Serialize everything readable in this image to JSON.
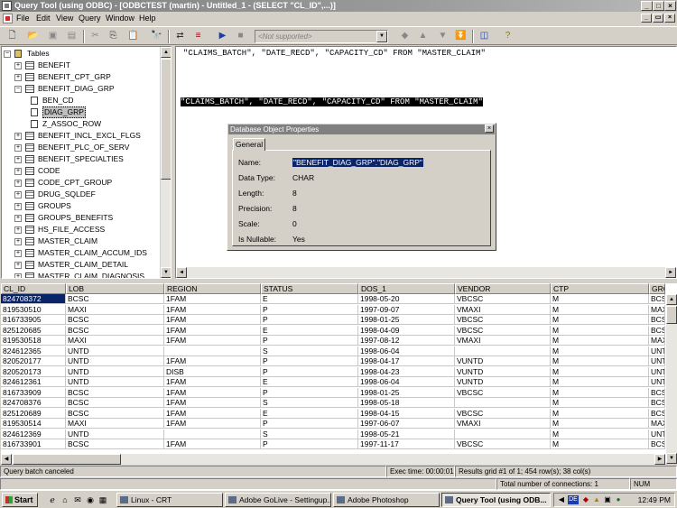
{
  "window": {
    "title": "Query Tool (using ODBC) - [ODBCTEST (martin) - Untitled_1 - (SELECT \"CL_ID\",...)]"
  },
  "menu": [
    "File",
    "Edit",
    "View",
    "Query",
    "Window",
    "Help"
  ],
  "toolbar": {
    "combo_placeholder": "<Not supported>"
  },
  "tree": {
    "root": "Tables",
    "items": [
      {
        "label": "BENEFIT",
        "expanded": false
      },
      {
        "label": "BENEFIT_CPT_GRP",
        "expanded": false
      },
      {
        "label": "BENEFIT_DIAG_GRP",
        "expanded": true
      },
      {
        "label": "BEN_CD",
        "child": true
      },
      {
        "label": "DIAG_GRP",
        "child": true,
        "selected": true
      },
      {
        "label": "Z_ASSOC_ROW",
        "child": true
      },
      {
        "label": "BENEFIT_INCL_EXCL_FLGS",
        "expanded": false
      },
      {
        "label": "BENEFIT_PLC_OF_SERV",
        "expanded": false
      },
      {
        "label": "BENEFIT_SPECIALTIES",
        "expanded": false
      },
      {
        "label": "CODE",
        "expanded": false
      },
      {
        "label": "CODE_CPT_GROUP",
        "expanded": false
      },
      {
        "label": "DRUG_SQLDEF",
        "expanded": false
      },
      {
        "label": "GROUPS",
        "expanded": false
      },
      {
        "label": "GROUPS_BENEFITS",
        "expanded": false
      },
      {
        "label": "HS_FILE_ACCESS",
        "expanded": false
      },
      {
        "label": "MASTER_CLAIM",
        "expanded": false
      },
      {
        "label": "MASTER_CLAIM_ACCUM_IDS",
        "expanded": false
      },
      {
        "label": "MASTER_CLAIM_DETAIL",
        "expanded": false
      },
      {
        "label": "MASTER_CLAIM_DIAGNOSIS",
        "expanded": false
      }
    ]
  },
  "sql": {
    "line1": "\"CLAIMS_BATCH\", \"DATE_RECD\", \"CAPACITY_CD\" FROM \"MASTER_CLAIM\"",
    "line2": "\"CLAIMS_BATCH\", \"DATE_RECD\", \"CAPACITY_CD\" FROM \"MASTER_CLAIM\""
  },
  "dialog": {
    "title": "Database Object Properties",
    "tab": "General",
    "close": "×",
    "props": [
      {
        "label": "Name:",
        "value": "\"BENEFIT_DIAG_GRP\".\"DIAG_GRP\"",
        "selected": true
      },
      {
        "label": "Data Type:",
        "value": "CHAR"
      },
      {
        "label": "Length:",
        "value": "8"
      },
      {
        "label": "Precision:",
        "value": "8"
      },
      {
        "label": "Scale:",
        "value": "0"
      },
      {
        "label": "Is Nullable:",
        "value": "Yes"
      }
    ]
  },
  "grid": {
    "columns": [
      "CL_ID",
      "LOB",
      "REGION",
      "STATUS",
      "DOS_1",
      "VENDOR",
      "CTP",
      "GRO"
    ],
    "rows": [
      [
        "824708372",
        "BCSC",
        "1FAM",
        "E",
        "1998-05-20",
        "VBCSC",
        "M",
        "BCS"
      ],
      [
        "819530510",
        "MAXI",
        "1FAM",
        "P",
        "1997-09-07",
        "VMAXI",
        "M",
        "MAX"
      ],
      [
        "816733905",
        "BCSC",
        "1FAM",
        "P",
        "1998-01-25",
        "VBCSC",
        "M",
        "BCS"
      ],
      [
        "825120685",
        "BCSC",
        "1FAM",
        "E",
        "1998-04-09",
        "VBCSC",
        "M",
        "BCS"
      ],
      [
        "819530518",
        "MAXI",
        "1FAM",
        "P",
        "1997-08-12",
        "VMAXI",
        "M",
        "MAX"
      ],
      [
        "824612365",
        "UNTD",
        "",
        "S",
        "1998-06-04",
        "",
        "M",
        "UNT"
      ],
      [
        "820520177",
        "UNTD",
        "1FAM",
        "P",
        "1998-04-17",
        "VUNTD",
        "M",
        "UNT"
      ],
      [
        "820520173",
        "UNTD",
        "DISB",
        "P",
        "1998-04-23",
        "VUNTD",
        "M",
        "UNT"
      ],
      [
        "824612361",
        "UNTD",
        "1FAM",
        "E",
        "1998-06-04",
        "VUNTD",
        "M",
        "UNT"
      ],
      [
        "816733909",
        "BCSC",
        "1FAM",
        "P",
        "1998-01-25",
        "VBCSC",
        "M",
        "BCS"
      ],
      [
        "824708376",
        "BCSC",
        "1FAM",
        "S",
        "1998-05-18",
        "",
        "M",
        "BCS"
      ],
      [
        "825120689",
        "BCSC",
        "1FAM",
        "E",
        "1998-04-15",
        "VBCSC",
        "M",
        "BCS"
      ],
      [
        "819530514",
        "MAXI",
        "1FAM",
        "P",
        "1997-06-07",
        "VMAXI",
        "M",
        "MAX"
      ],
      [
        "824612369",
        "UNTD",
        "",
        "S",
        "1998-05-21",
        "",
        "M",
        "UNT"
      ],
      [
        "816733901",
        "BCSC",
        "1FAM",
        "P",
        "1997-11-17",
        "VBCSC",
        "M",
        "BCS"
      ]
    ]
  },
  "status": {
    "message": "Query batch canceled",
    "exec_time": "Exec time: 00:00:01",
    "results": "Results grid #1 of 1; 454 row(s); 38 col(s)",
    "connections": "Total number of connections: 1",
    "num": "NUM"
  },
  "taskbar": {
    "start": "Start",
    "tasks": [
      "Linux - CRT",
      "Adobe GoLive - Settingup...",
      "Adobe Photoshop",
      "Query Tool (using ODB..."
    ],
    "tray_lang": "DE",
    "clock": "12:49 PM"
  }
}
